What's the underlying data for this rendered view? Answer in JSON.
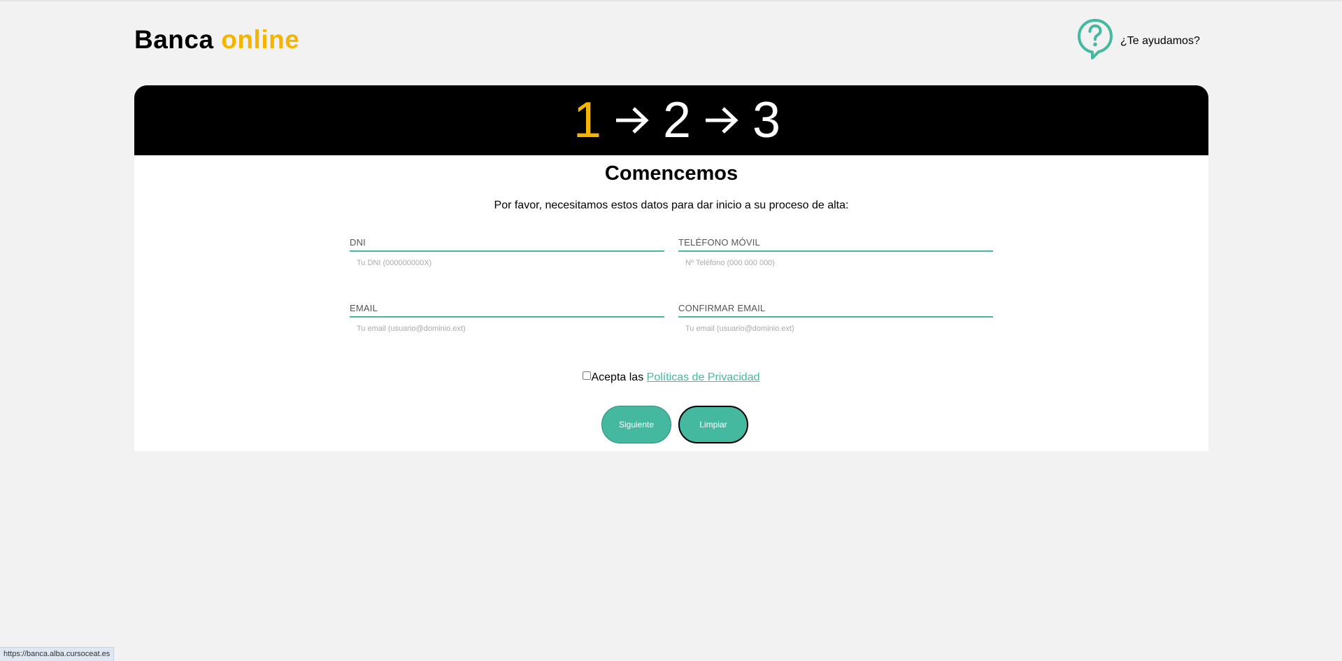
{
  "header": {
    "logo_main": "Banca",
    "logo_accent": "online",
    "help_label": "¿Te ayudamos?",
    "help_icon": "question-bubble-icon"
  },
  "steps": {
    "items": [
      "1",
      "2",
      "3"
    ],
    "active": "1",
    "separator_icon": "arrow-right-icon"
  },
  "form": {
    "title": "Comencemos",
    "subtitle": "Por favor, necesitamos estos datos para dar inicio a su proceso de alta:",
    "dni": {
      "label": "DNI",
      "value": "",
      "placeholder": "Tu DNI (000000000X)"
    },
    "phone": {
      "label": "TELÉFONO MÓVIL",
      "value": "",
      "placeholder": "Nº Teléfono (000 000 000)"
    },
    "email": {
      "label": "EMAIL",
      "value": "",
      "placeholder": "Tu email (usuario@dominio.ext)"
    },
    "confirm_email": {
      "label": "CONFIRMAR EMAIL",
      "value": "",
      "placeholder": "Tu email (usuario@dominio.ext)"
    },
    "consent": {
      "checked": false,
      "text": "Acepta las ",
      "link_text": "Políticas de Privacidad"
    },
    "buttons": {
      "next": "Siguiente",
      "clear": "Limpiar"
    }
  },
  "status_bar": {
    "url": "https://banca.alba.cursoceat.es"
  },
  "colors": {
    "accent": "#f5b400",
    "brand_teal": "#45b9a0",
    "header_bg": "#000000",
    "page_bg": "#f2f2f2"
  }
}
